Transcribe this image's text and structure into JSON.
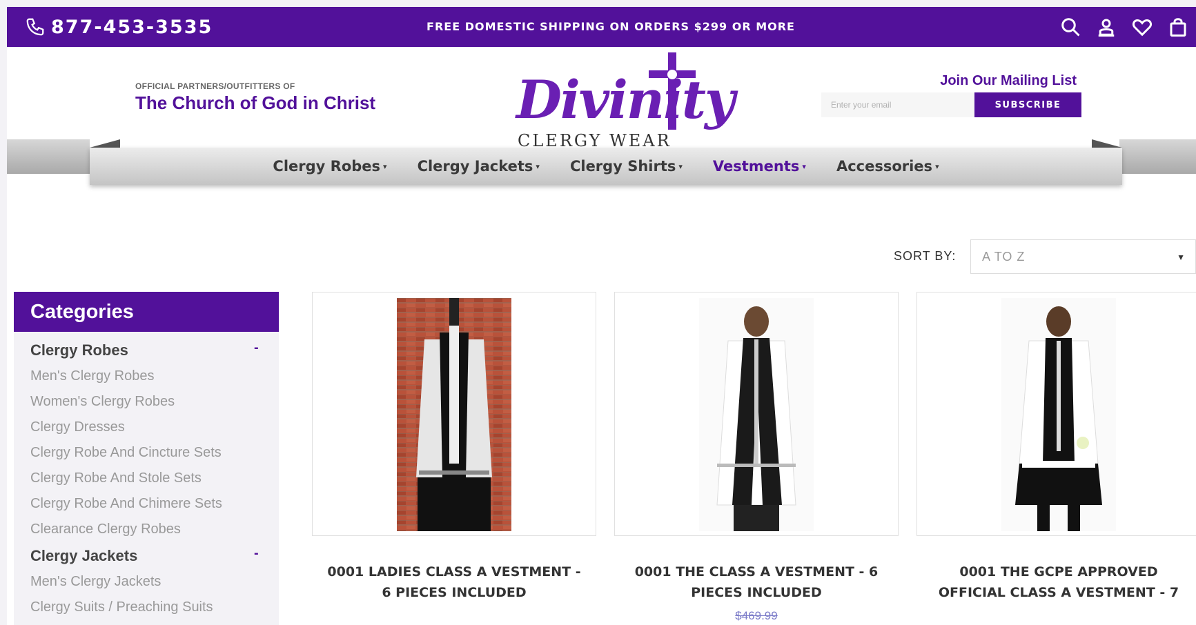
{
  "topbar": {
    "phone": "877-453-3535",
    "promo": "FREE DOMESTIC SHIPPING ON ORDERS $299 OR MORE",
    "icons": [
      "search-icon",
      "account-icon",
      "heart-icon",
      "bag-icon"
    ]
  },
  "header": {
    "partners_small": "OFFICIAL PARTNERS/OUTFITTERS OF",
    "partners_big": "The Church of God in Christ",
    "logo_word": "Divinity",
    "logo_sub": "CLERGY WEAR",
    "mailing": {
      "title": "Join Our Mailing List",
      "placeholder": "Enter your email",
      "button": "SUBSCRIBE"
    }
  },
  "nav": {
    "items": [
      {
        "label": "Clergy Robes"
      },
      {
        "label": "Clergy Jackets"
      },
      {
        "label": "Clergy Shirts"
      },
      {
        "label": "Vestments"
      },
      {
        "label": "Accessories"
      }
    ],
    "active": "Vestments"
  },
  "sort": {
    "label": "SORT BY:",
    "value": "A TO Z"
  },
  "sidebar": {
    "title": "Categories",
    "groups": [
      {
        "label": "Clergy Robes",
        "toggle": "-",
        "items": [
          "Men's Clergy Robes",
          "Women's Clergy Robes",
          "Clergy Dresses",
          "Clergy Robe And Cincture Sets",
          "Clergy Robe And Stole Sets",
          "Clergy Robe And Chimere Sets",
          "Clearance Clergy Robes"
        ]
      },
      {
        "label": "Clergy Jackets",
        "toggle": "-",
        "items": [
          "Men's Clergy Jackets",
          "Clergy Suits / Preaching Suits"
        ]
      }
    ]
  },
  "products": [
    {
      "title_1": "0001 LADIES CLASS A VESTMENT -",
      "title_2": "6 PIECES INCLUDED",
      "price": ""
    },
    {
      "title_1": "0001 THE CLASS A VESTMENT - 6",
      "title_2": "PIECES INCLUDED",
      "price": "$469.99"
    },
    {
      "title_1": "0001 THE GCPE APPROVED",
      "title_2": "OFFICIAL CLASS A VESTMENT - 7",
      "price": ""
    }
  ],
  "colors": {
    "brand_purple": "#52119a",
    "sidebar_bg": "#f3f2f6",
    "nav_grey": "#c4c4c4"
  }
}
